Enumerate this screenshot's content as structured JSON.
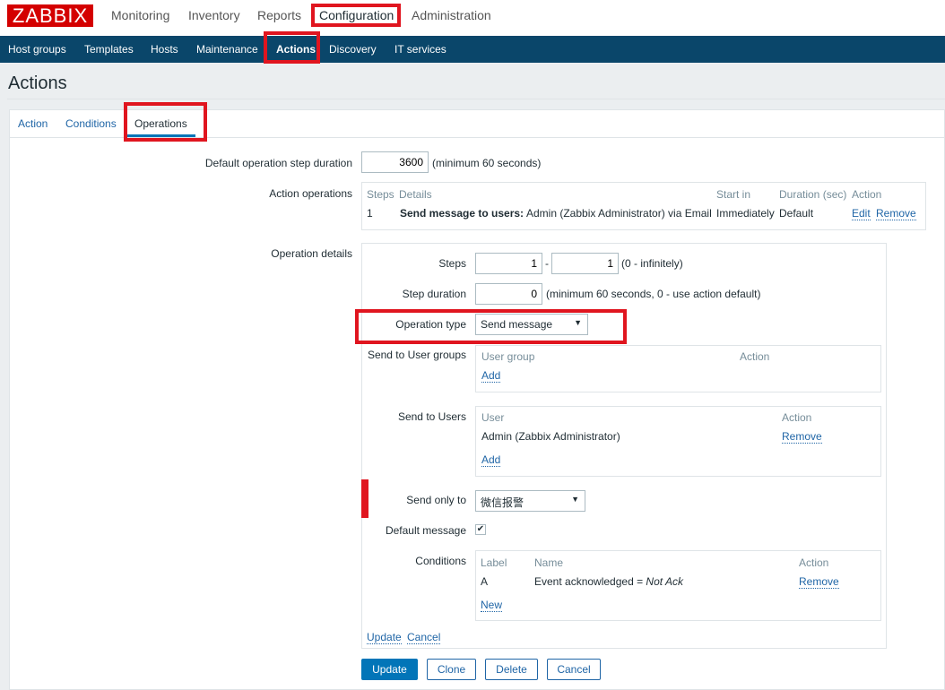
{
  "logo": "ZABBIX",
  "top_menu": [
    "Monitoring",
    "Inventory",
    "Reports",
    "Configuration",
    "Administration"
  ],
  "sub_menu": [
    "Host groups",
    "Templates",
    "Hosts",
    "Maintenance",
    "Actions",
    "Discovery",
    "IT services"
  ],
  "page_title": "Actions",
  "tabs": [
    "Action",
    "Conditions",
    "Operations"
  ],
  "form": {
    "step_duration_label": "Default operation step duration",
    "step_duration_value": "3600",
    "step_duration_hint": "(minimum 60 seconds)",
    "action_ops_label": "Action operations",
    "ops_headers": [
      "Steps",
      "Details",
      "Start in",
      "Duration (sec)",
      "Action"
    ],
    "ops_row": {
      "steps": "1",
      "details_bold": "Send message to users:",
      "details": "Admin (Zabbix Administrator) via Email",
      "start": "Immediately",
      "duration": "Default",
      "edit": "Edit",
      "remove": "Remove"
    },
    "op_details_label": "Operation details",
    "steps_label": "Steps",
    "steps_from": "1",
    "steps_to": "1",
    "steps_hint": "(0 - infinitely)",
    "dash": "-",
    "step_dur_label": "Step duration",
    "step_dur_value": "0",
    "step_dur_hint": "(minimum 60 seconds, 0 - use action default)",
    "op_type_label": "Operation type",
    "op_type_value": "Send message",
    "usergroups_label": "Send to User groups",
    "ug_headers": [
      "User group",
      "Action"
    ],
    "ug_add": "Add",
    "users_label": "Send to Users",
    "u_headers": [
      "User",
      "Action"
    ],
    "u_row": "Admin (Zabbix Administrator)",
    "u_remove": "Remove",
    "u_add": "Add",
    "send_only_label": "Send only to",
    "send_only_value": "微信报警",
    "default_msg_label": "Default message",
    "default_msg_checked": true,
    "conditions_label": "Conditions",
    "c_headers": [
      "Label",
      "Name",
      "Action"
    ],
    "c_row": {
      "label": "A",
      "name": "Event acknowledged = ",
      "value": "Not Ack",
      "remove": "Remove"
    },
    "c_new": "New",
    "update_link": "Update",
    "cancel_link": "Cancel"
  },
  "buttons": [
    "Update",
    "Clone",
    "Delete",
    "Cancel"
  ],
  "colors": {
    "brand": "#d40000",
    "nav": "#0a466a",
    "link": "#1f65a6",
    "highlight": "#e0151f"
  }
}
